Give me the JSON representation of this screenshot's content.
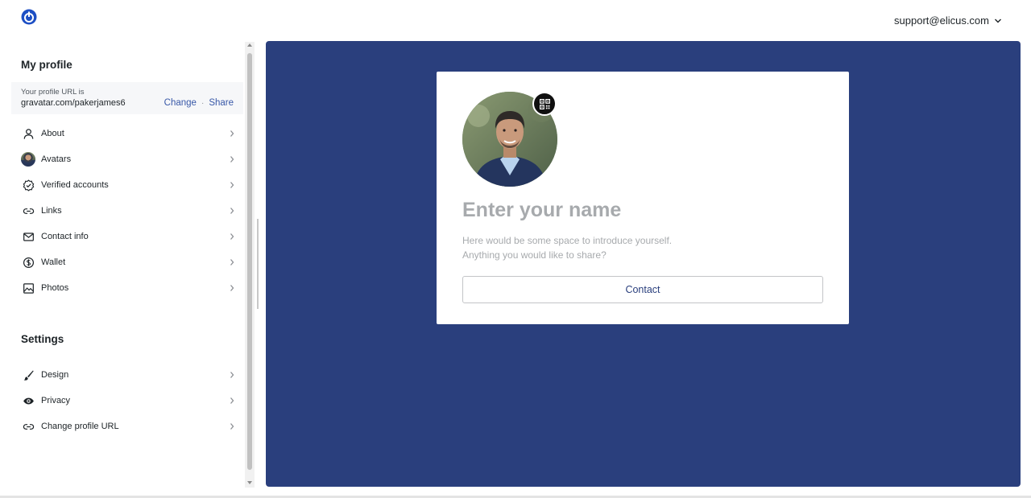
{
  "header": {
    "account_email": "support@elicus.com"
  },
  "sidebar": {
    "profile_title": "My profile",
    "profile_url": {
      "label": "Your profile URL is",
      "value": "gravatar.com/pakerjames6",
      "change_label": "Change",
      "separator": "·",
      "share_label": "Share"
    },
    "profile_items": [
      {
        "label": "About",
        "icon": "person-icon"
      },
      {
        "label": "Avatars",
        "icon": "avatar-thumbnail"
      },
      {
        "label": "Verified accounts",
        "icon": "verified-badge-icon"
      },
      {
        "label": "Links",
        "icon": "link-icon"
      },
      {
        "label": "Contact info",
        "icon": "envelope-icon"
      },
      {
        "label": "Wallet",
        "icon": "dollar-coin-icon"
      },
      {
        "label": "Photos",
        "icon": "image-icon"
      }
    ],
    "settings_title": "Settings",
    "settings_items": [
      {
        "label": "Design",
        "icon": "brush-icon"
      },
      {
        "label": "Privacy",
        "icon": "eye-icon"
      },
      {
        "label": "Change profile URL",
        "icon": "link-icon"
      }
    ]
  },
  "preview": {
    "background_color": "#2a3f7d",
    "name_placeholder": "Enter your name",
    "bio_line1": "Here would be some space to introduce yourself.",
    "bio_line2": "Anything you would like to share?",
    "contact_label": "Contact"
  }
}
